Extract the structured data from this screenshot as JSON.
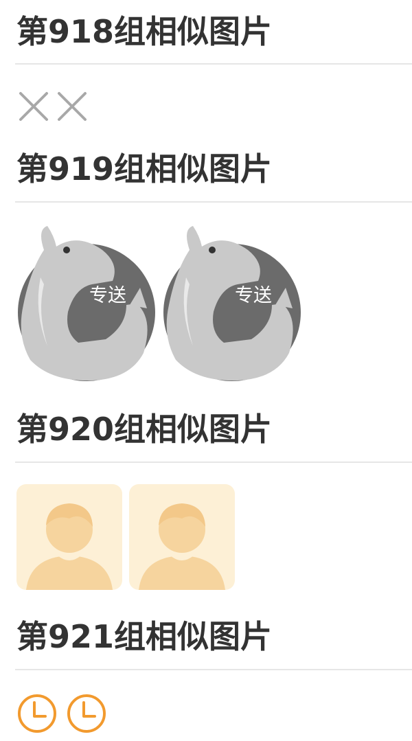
{
  "groups": [
    {
      "title": "第918组相似图片",
      "images": [
        {
          "icon": "close-x-icon"
        },
        {
          "icon": "close-x-icon"
        }
      ]
    },
    {
      "title": "第919组相似图片",
      "images": [
        {
          "icon": "kangaroo-delivery-icon",
          "label": "专送"
        },
        {
          "icon": "kangaroo-delivery-icon",
          "label": "专送"
        }
      ]
    },
    {
      "title": "第920组相似图片",
      "images": [
        {
          "icon": "default-avatar-icon"
        },
        {
          "icon": "default-avatar-icon"
        }
      ]
    },
    {
      "title": "第921组相似图片",
      "images": [
        {
          "icon": "clock-icon"
        },
        {
          "icon": "clock-icon"
        }
      ]
    }
  ],
  "colors": {
    "title": "#333333",
    "divider": "#e6e6e6",
    "x_icon": "#a8a8a8",
    "kangaroo_dark": "#6b6b6b",
    "kangaroo_light": "#c9c9c9",
    "avatar_bg": "#fdf0d6",
    "avatar_figure": "#f6d49e",
    "clock": "#f29a2e"
  }
}
